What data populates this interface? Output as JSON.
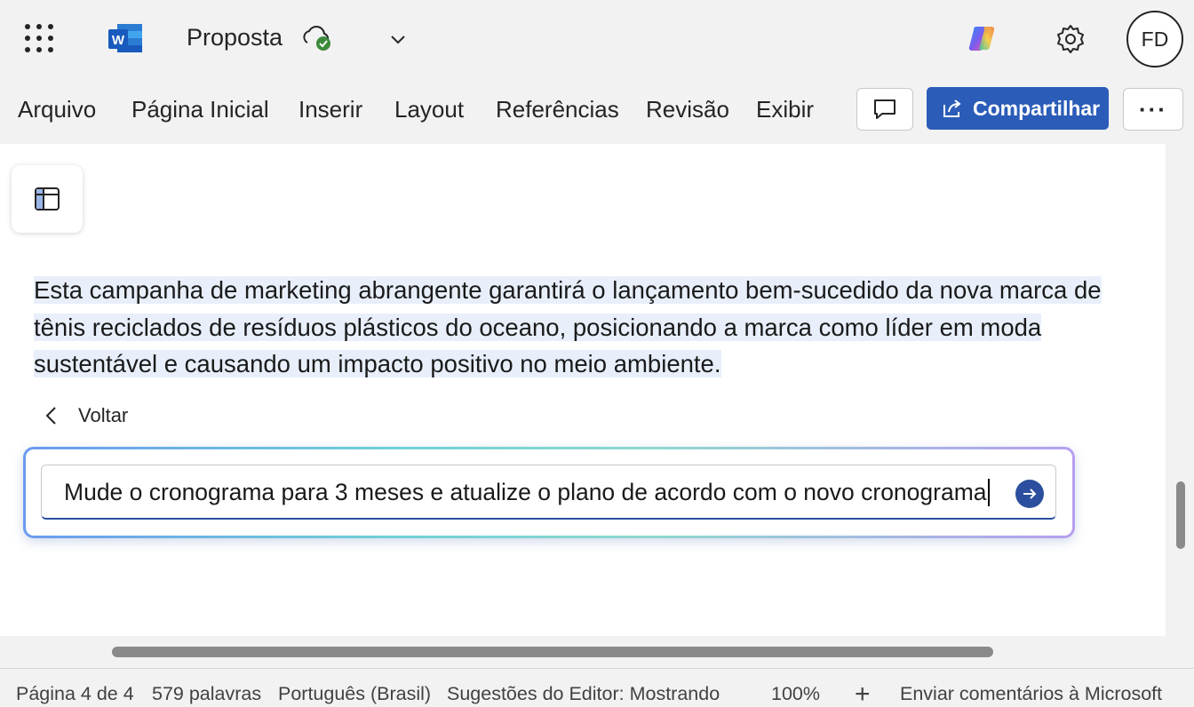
{
  "app": {
    "name": "Word",
    "logo_letter": "W",
    "icon": "word-logo-icon"
  },
  "titlebar": {
    "doc_title": "Proposta",
    "cloud_status_icon": "cloud-saved-icon",
    "avatar_initials": "FD"
  },
  "ribbon": {
    "tabs": [
      {
        "label": "Arquivo"
      },
      {
        "label": "Página Inicial"
      },
      {
        "label": "Inserir"
      },
      {
        "label": "Layout"
      },
      {
        "label": "Referências"
      },
      {
        "label": "Revisão"
      },
      {
        "label": "Exibir"
      }
    ],
    "share_label": "Compartilhar",
    "more_label": "···"
  },
  "document": {
    "paragraph": "Esta campanha de marketing abrangente garantirá o lançamento bem-sucedido da nova marca de tênis reciclados de resíduos plásticos do oceano, posicionando a marca como líder em moda sustentável e causando um impacto positivo no meio ambiente."
  },
  "copilot_prompt": {
    "back_label": "Voltar",
    "input_value": "Mude o cronograma para 3 meses e atualize o plano de acordo com o novo cronograma"
  },
  "statusbar": {
    "page": "Página 4 de 4",
    "words": "579 palavras",
    "language": "Português (Brasil)",
    "editor": "Sugestões do Editor: Mostrando",
    "zoom": "100%",
    "zoom_in": "+",
    "feedback": "Enviar comentários à Microsoft"
  },
  "colors": {
    "accent": "#2b5cb8",
    "highlight": "#e8effb",
    "saved_check": "#3c8a3c"
  }
}
